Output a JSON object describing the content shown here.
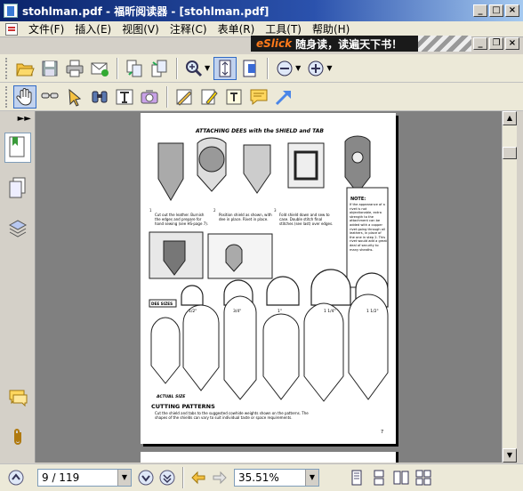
{
  "window": {
    "title": "stohlman.pdf - 福昕阅读器 - [stohlman.pdf]"
  },
  "menu": {
    "items": [
      {
        "label": "文件(F)"
      },
      {
        "label": "插入(E)"
      },
      {
        "label": "视图(V)"
      },
      {
        "label": "注释(C)"
      },
      {
        "label": "表单(R)"
      },
      {
        "label": "工具(T)"
      },
      {
        "label": "帮助(H)"
      }
    ]
  },
  "ad": {
    "brand": "eSlick",
    "text": "随身读，读遍天下书！"
  },
  "toolbar": {
    "icons": [
      "open-icon",
      "save-icon",
      "print-icon",
      "email-icon",
      "page-extract-icon",
      "page-insert-icon",
      "zoom-icon",
      "fit-page-icon",
      "fit-width-icon",
      "zoom-out-icon",
      "zoom-in-icon",
      "hand-icon",
      "select-text-icon",
      "select-icon",
      "find-icon",
      "typewriter-icon",
      "snapshot-icon",
      "note-icon",
      "highlight-icon",
      "textbox-icon",
      "comment-icon",
      "arrow-icon"
    ]
  },
  "document": {
    "page_heading": "ATTACHING DEES with the SHIELD and TAB",
    "step1": "Cut out the leather. Burnish the edges and prepare for hand sewing (see HS-page 7).",
    "step2": "Position shield as shown, with dee in place. Rivet in place.",
    "step3": "Fold shield down and sew to case. Double stitch final stitches (see last) over edges.",
    "note_title": "NOTE:",
    "note_text": "If the appearance of a rivet is not objectionable, extra strength to the attachment can be added with a copper rivet going through all leathers, in place of the one in step 2. This rivet would add a great deal of security to many sheaths.",
    "dee_sizes_label": "DEE SIZES",
    "actual_size_label": "ACTUAL SIZE",
    "cutting_patterns_label": "CUTTING PATTERNS",
    "footer_text": "Cut the shield and tabs to the suggested cowhide weights shown on the patterns. The shapes of the shields can vary to suit individual taste or space requirements.",
    "page_number": "7",
    "dee_sizes": [
      "1/2\"",
      "3/4\"",
      "1\"",
      "1 1/4\"",
      "1 1/2\""
    ]
  },
  "status": {
    "page_indicator": "9 / 119",
    "zoom": "35.51%"
  }
}
